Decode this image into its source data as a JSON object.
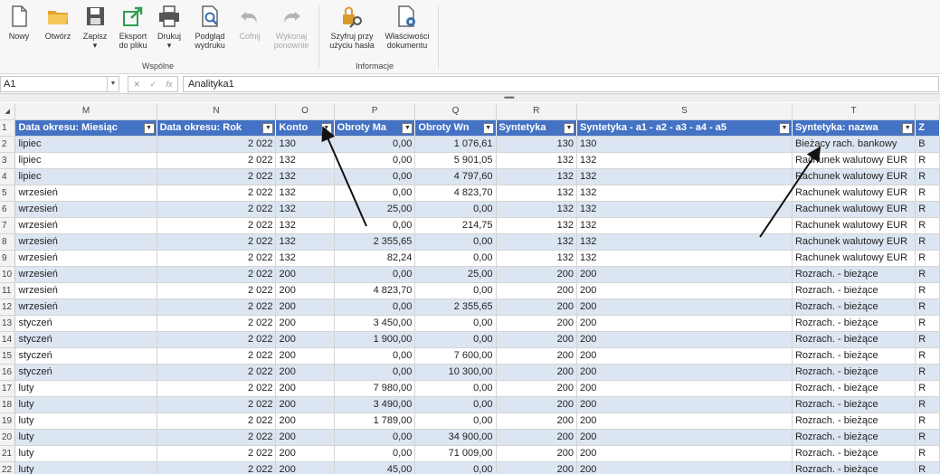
{
  "ribbon": {
    "buttons": [
      {
        "id": "new",
        "label": "Nowy",
        "icon": "new-document-icon",
        "disabled": false
      },
      {
        "id": "open",
        "label": "Otwórz",
        "icon": "folder-open-icon",
        "disabled": false
      },
      {
        "id": "save",
        "label": "Zapisz",
        "icon": "save-icon",
        "disabled": false
      },
      {
        "id": "export",
        "label": "Eksport do pliku",
        "icon": "export-icon",
        "disabled": false
      },
      {
        "id": "print",
        "label": "Drukuj",
        "icon": "printer-icon",
        "disabled": false
      },
      {
        "id": "preview",
        "label": "Podgląd wydruku",
        "icon": "print-preview-icon",
        "disabled": false
      },
      {
        "id": "undo",
        "label": "Cofnij",
        "icon": "undo-icon",
        "disabled": true
      },
      {
        "id": "redo",
        "label": "Wykonaj ponownie",
        "icon": "redo-icon",
        "disabled": true
      },
      {
        "id": "encrypt",
        "label": "Szyfruj przy użyciu hasła",
        "icon": "lock-key-icon",
        "disabled": false
      },
      {
        "id": "props",
        "label": "Właściwości dokumentu",
        "icon": "document-properties-icon",
        "disabled": false
      }
    ],
    "save_dropdown": "▾",
    "print_dropdown": "▾",
    "group_common": "Wspólne",
    "group_info": "Informacje"
  },
  "formula_bar": {
    "name_box": "A1",
    "fx_label": "fx",
    "content": "Analityka1"
  },
  "splitter_dots": "•••••",
  "accent_color": "#4472c4",
  "band_color": "#dce6f2",
  "grid": {
    "col_letters": [
      "M",
      "N",
      "O",
      "P",
      "Q",
      "R",
      "S",
      "T",
      ""
    ],
    "header_row_num": "1",
    "headers": [
      "Data okresu: Miesiąc",
      "Data okresu: Rok",
      "Konto",
      "Obroty Ma",
      "Obroty Wn",
      "Syntetyka",
      "Syntetyka - a1 - a2 - a3 - a4 - a5",
      "Syntetyka: nazwa",
      "Z"
    ],
    "rows": [
      {
        "n": "2",
        "m": "lipiec",
        "rok": "2 022",
        "konto": "130",
        "ma": "0,00",
        "wn": "1 076,61",
        "syn": "130",
        "syn5": "130",
        "nazwa": "Bieżący rach. bankowy",
        "x": "B"
      },
      {
        "n": "3",
        "m": "lipiec",
        "rok": "2 022",
        "konto": "132",
        "ma": "0,00",
        "wn": "5 901,05",
        "syn": "132",
        "syn5": "132",
        "nazwa": "Rachunek walutowy EUR",
        "x": "R"
      },
      {
        "n": "4",
        "m": "lipiec",
        "rok": "2 022",
        "konto": "132",
        "ma": "0,00",
        "wn": "4 797,60",
        "syn": "132",
        "syn5": "132",
        "nazwa": "Rachunek walutowy EUR",
        "x": "R"
      },
      {
        "n": "5",
        "m": "wrzesień",
        "rok": "2 022",
        "konto": "132",
        "ma": "0,00",
        "wn": "4 823,70",
        "syn": "132",
        "syn5": "132",
        "nazwa": "Rachunek walutowy EUR",
        "x": "R"
      },
      {
        "n": "6",
        "m": "wrzesień",
        "rok": "2 022",
        "konto": "132",
        "ma": "25,00",
        "wn": "0,00",
        "syn": "132",
        "syn5": "132",
        "nazwa": "Rachunek walutowy EUR",
        "x": "R"
      },
      {
        "n": "7",
        "m": "wrzesień",
        "rok": "2 022",
        "konto": "132",
        "ma": "0,00",
        "wn": "214,75",
        "syn": "132",
        "syn5": "132",
        "nazwa": "Rachunek walutowy EUR",
        "x": "R"
      },
      {
        "n": "8",
        "m": "wrzesień",
        "rok": "2 022",
        "konto": "132",
        "ma": "2 355,65",
        "wn": "0,00",
        "syn": "132",
        "syn5": "132",
        "nazwa": "Rachunek walutowy EUR",
        "x": "R"
      },
      {
        "n": "9",
        "m": "wrzesień",
        "rok": "2 022",
        "konto": "132",
        "ma": "82,24",
        "wn": "0,00",
        "syn": "132",
        "syn5": "132",
        "nazwa": "Rachunek walutowy EUR",
        "x": "R"
      },
      {
        "n": "10",
        "m": "wrzesień",
        "rok": "2 022",
        "konto": "200",
        "ma": "0,00",
        "wn": "25,00",
        "syn": "200",
        "syn5": "200",
        "nazwa": "Rozrach. - bieżące",
        "x": "R"
      },
      {
        "n": "11",
        "m": "wrzesień",
        "rok": "2 022",
        "konto": "200",
        "ma": "4 823,70",
        "wn": "0,00",
        "syn": "200",
        "syn5": "200",
        "nazwa": "Rozrach. - bieżące",
        "x": "R"
      },
      {
        "n": "12",
        "m": "wrzesień",
        "rok": "2 022",
        "konto": "200",
        "ma": "0,00",
        "wn": "2 355,65",
        "syn": "200",
        "syn5": "200",
        "nazwa": "Rozrach. - bieżące",
        "x": "R"
      },
      {
        "n": "13",
        "m": "styczeń",
        "rok": "2 022",
        "konto": "200",
        "ma": "3 450,00",
        "wn": "0,00",
        "syn": "200",
        "syn5": "200",
        "nazwa": "Rozrach. - bieżące",
        "x": "R"
      },
      {
        "n": "14",
        "m": "styczeń",
        "rok": "2 022",
        "konto": "200",
        "ma": "1 900,00",
        "wn": "0,00",
        "syn": "200",
        "syn5": "200",
        "nazwa": "Rozrach. - bieżące",
        "x": "R"
      },
      {
        "n": "15",
        "m": "styczeń",
        "rok": "2 022",
        "konto": "200",
        "ma": "0,00",
        "wn": "7 600,00",
        "syn": "200",
        "syn5": "200",
        "nazwa": "Rozrach. - bieżące",
        "x": "R"
      },
      {
        "n": "16",
        "m": "styczeń",
        "rok": "2 022",
        "konto": "200",
        "ma": "0,00",
        "wn": "10 300,00",
        "syn": "200",
        "syn5": "200",
        "nazwa": "Rozrach. - bieżące",
        "x": "R"
      },
      {
        "n": "17",
        "m": "luty",
        "rok": "2 022",
        "konto": "200",
        "ma": "7 980,00",
        "wn": "0,00",
        "syn": "200",
        "syn5": "200",
        "nazwa": "Rozrach. - bieżące",
        "x": "R"
      },
      {
        "n": "18",
        "m": "luty",
        "rok": "2 022",
        "konto": "200",
        "ma": "3 490,00",
        "wn": "0,00",
        "syn": "200",
        "syn5": "200",
        "nazwa": "Rozrach. - bieżące",
        "x": "R"
      },
      {
        "n": "19",
        "m": "luty",
        "rok": "2 022",
        "konto": "200",
        "ma": "1 789,00",
        "wn": "0,00",
        "syn": "200",
        "syn5": "200",
        "nazwa": "Rozrach. - bieżące",
        "x": "R"
      },
      {
        "n": "20",
        "m": "luty",
        "rok": "2 022",
        "konto": "200",
        "ma": "0,00",
        "wn": "34 900,00",
        "syn": "200",
        "syn5": "200",
        "nazwa": "Rozrach. - bieżące",
        "x": "R"
      },
      {
        "n": "21",
        "m": "luty",
        "rok": "2 022",
        "konto": "200",
        "ma": "0,00",
        "wn": "71 009,00",
        "syn": "200",
        "syn5": "200",
        "nazwa": "Rozrach. - bieżące",
        "x": "R"
      },
      {
        "n": "22",
        "m": "luty",
        "rok": "2 022",
        "konto": "200",
        "ma": "45,00",
        "wn": "0,00",
        "syn": "200",
        "syn5": "200",
        "nazwa": "Rozrach. - bieżące",
        "x": "R"
      }
    ]
  }
}
